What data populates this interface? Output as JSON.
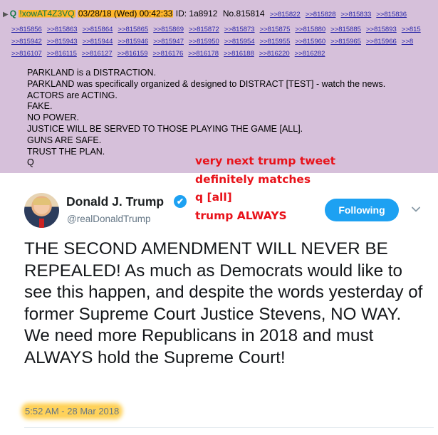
{
  "post": {
    "marker": "▶",
    "name": "Q",
    "tripcode": "!xowAT4Z3VQ",
    "date": "03/28/18 (Wed) 00:42:33",
    "id": "ID: 1a8912",
    "number": "No.815814",
    "replies": [
      [
        ">>815822",
        ">>815828",
        ">>815833",
        ">>815836"
      ],
      [
        ">>815856",
        ">>815863",
        ">>815864",
        ">>815865",
        ">>815869",
        ">>815872",
        ">>815873",
        ">>815875",
        ">>815880",
        ">>815885",
        ">>815893",
        ">>815"
      ],
      [
        ">>815942",
        ">>815943",
        ">>815944",
        ">>815946",
        ">>815947",
        ">>815950",
        ">>815954",
        ">>815955",
        ">>815960",
        ">>815965",
        ">>815966",
        ">>8"
      ],
      [
        ">>816107",
        ">>816115",
        ">>816127",
        ">>816159",
        ">>816176",
        ">>816178",
        ">>816188",
        ">>816220",
        ">>816282"
      ]
    ],
    "body": [
      "PARKLAND is a DISTRACTION.",
      "PARKLAND was specifically organized & designed to DISTRACT [TEST] - watch the news.",
      "ACTORS are ACTING.",
      "FAKE.",
      "NO POWER.",
      "JUSTICE WILL BE SERVED TO THOSE PLAYING THE GAME [ALL].",
      "GUNS ARE SAFE.",
      "TRUST THE PLAN.",
      "Q"
    ]
  },
  "annotation": {
    "lines": [
      "very next trump tweet",
      "definitely matches",
      "q [all]",
      "trump ALWAYS"
    ]
  },
  "tweet": {
    "display_name": "Donald J. Trump",
    "handle": "@realDonaldTrump",
    "verified_glyph": "✔",
    "follow_label": "Following",
    "text": "THE SECOND AMENDMENT WILL NEVER BE REPEALED! As much as Democrats would like to see this happen, and despite the words yesterday of former Supreme Court Justice Stevens, NO WAY. We need more Republicans in 2018 and must ALWAYS hold the Supreme Court!",
    "timestamp": "5:52 AM - 28 Mar 2018"
  },
  "colors": {
    "post_background": "#d6c0da",
    "reply_link": "#2b28a8",
    "highlight": "#ffb62b",
    "annotation": "#e8121a",
    "twitter_blue": "#1da1f2"
  },
  "icons": {
    "verified": "verified-badge-icon",
    "dropdown": "chevron-down-icon",
    "expand": "triangle-right-icon"
  }
}
